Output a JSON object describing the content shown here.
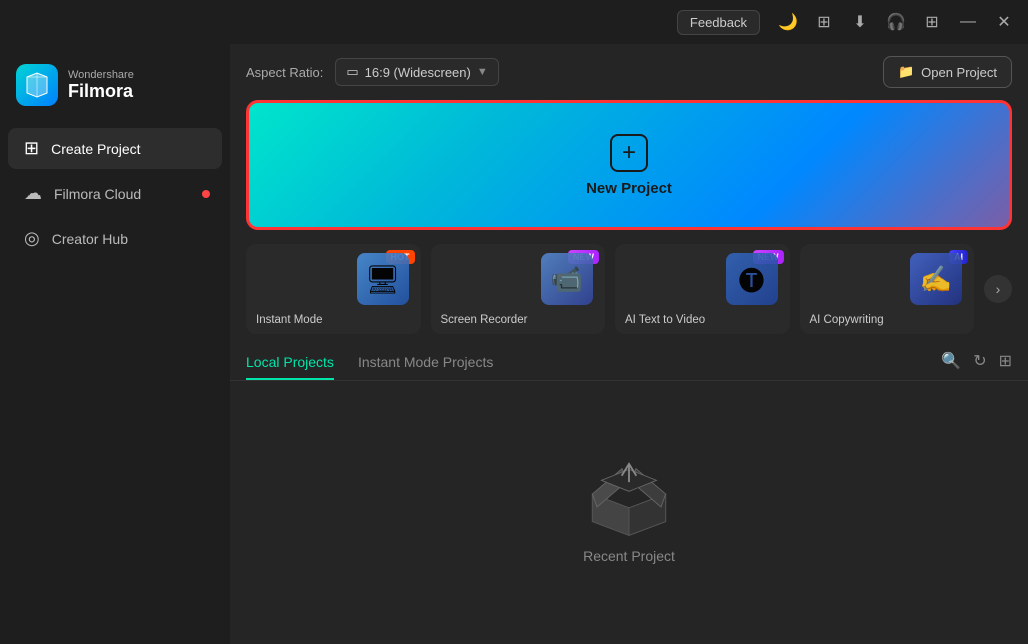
{
  "titlebar": {
    "feedback_label": "Feedback",
    "minimize_label": "—",
    "close_label": "✕"
  },
  "logo": {
    "brand": "Wondershare",
    "product": "Filmora"
  },
  "sidebar": {
    "items": [
      {
        "id": "create-project",
        "label": "Create Project",
        "icon": "⊞",
        "active": true
      },
      {
        "id": "filmora-cloud",
        "label": "Filmora Cloud",
        "icon": "☁",
        "active": false,
        "dot": true
      },
      {
        "id": "creator-hub",
        "label": "Creator Hub",
        "icon": "◎",
        "active": false
      }
    ]
  },
  "topbar": {
    "aspect_ratio_label": "Aspect Ratio:",
    "aspect_value": "16:9 (Widescreen)",
    "open_project_label": "Open Project"
  },
  "new_project": {
    "label": "New Project"
  },
  "feature_cards": [
    {
      "id": "instant-mode",
      "label": "Instant Mode",
      "badge": "HOT",
      "badge_type": "hot"
    },
    {
      "id": "screen-recorder",
      "label": "Screen Recorder",
      "badge": "NEW",
      "badge_type": "new"
    },
    {
      "id": "ai-text-to-video",
      "label": "AI Text to Video",
      "badge": "NEW",
      "badge_type": "new"
    },
    {
      "id": "ai-copywriting",
      "label": "AI Copywriting",
      "badge": "AI",
      "badge_type": "ai"
    }
  ],
  "projects_tabs": {
    "tabs": [
      {
        "id": "local",
        "label": "Local Projects",
        "active": true
      },
      {
        "id": "instant",
        "label": "Instant Mode Projects",
        "active": false
      }
    ]
  },
  "empty_state": {
    "label": "Recent Project"
  },
  "colors": {
    "accent_green": "#00e5aa",
    "accent_red": "#ff3333"
  }
}
